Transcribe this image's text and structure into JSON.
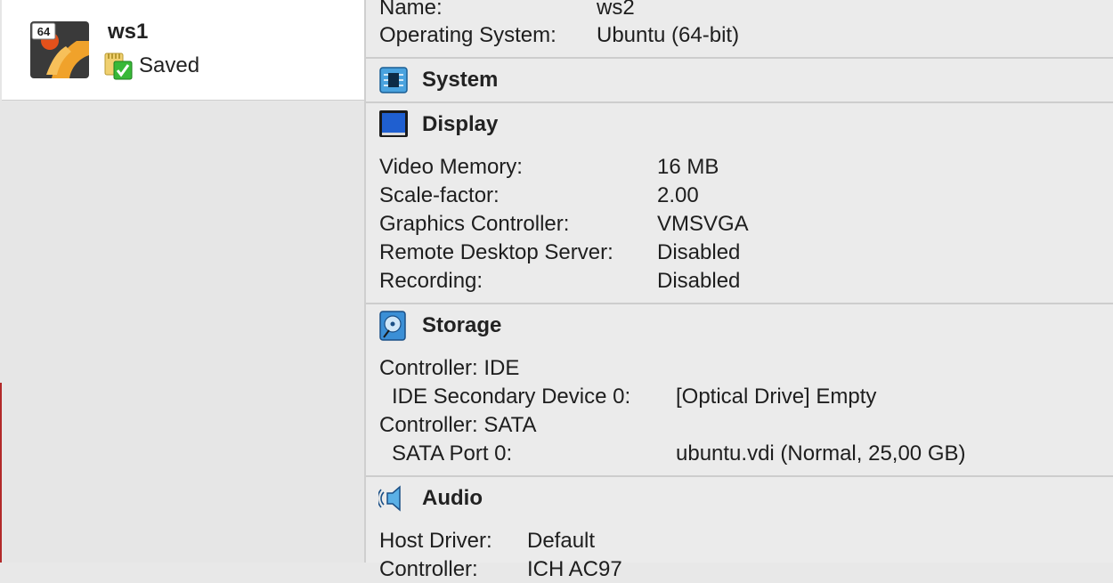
{
  "vm_list": {
    "items": [
      {
        "badge": "64",
        "name": "ws1",
        "state": "Saved"
      }
    ]
  },
  "general": {
    "rows": [
      {
        "key": "Name:",
        "value": "ws2"
      },
      {
        "key": "Operating System:",
        "value": "Ubuntu (64-bit)"
      }
    ]
  },
  "system": {
    "title": "System",
    "icon": "chip-icon"
  },
  "display": {
    "title": "Display",
    "icon": "monitor-icon",
    "rows": [
      {
        "key": "Video Memory:",
        "value": "16 MB"
      },
      {
        "key": "Scale-factor:",
        "value": "2.00"
      },
      {
        "key": "Graphics Controller:",
        "value": "VMSVGA"
      },
      {
        "key": "Remote Desktop Server:",
        "value": "Disabled"
      },
      {
        "key": "Recording:",
        "value": "Disabled"
      }
    ]
  },
  "storage": {
    "title": "Storage",
    "icon": "disk-icon",
    "rows": [
      {
        "key": "Controller: IDE",
        "value": ""
      },
      {
        "key": "IDE Secondary Device 0:",
        "value": "[Optical Drive] Empty"
      },
      {
        "key": "Controller: SATA",
        "value": ""
      },
      {
        "key": "SATA Port 0:",
        "value": "ubuntu.vdi (Normal, 25,00 GB)"
      }
    ]
  },
  "audio": {
    "title": "Audio",
    "icon": "speaker-icon",
    "rows": [
      {
        "key": "Host Driver:",
        "value": "Default"
      },
      {
        "key": "Controller:",
        "value": "ICH AC97"
      }
    ]
  },
  "colors": {
    "accent": "#1f5fd0",
    "selected_bg": "#ffffff",
    "panel_bg": "#ebebeb"
  }
}
